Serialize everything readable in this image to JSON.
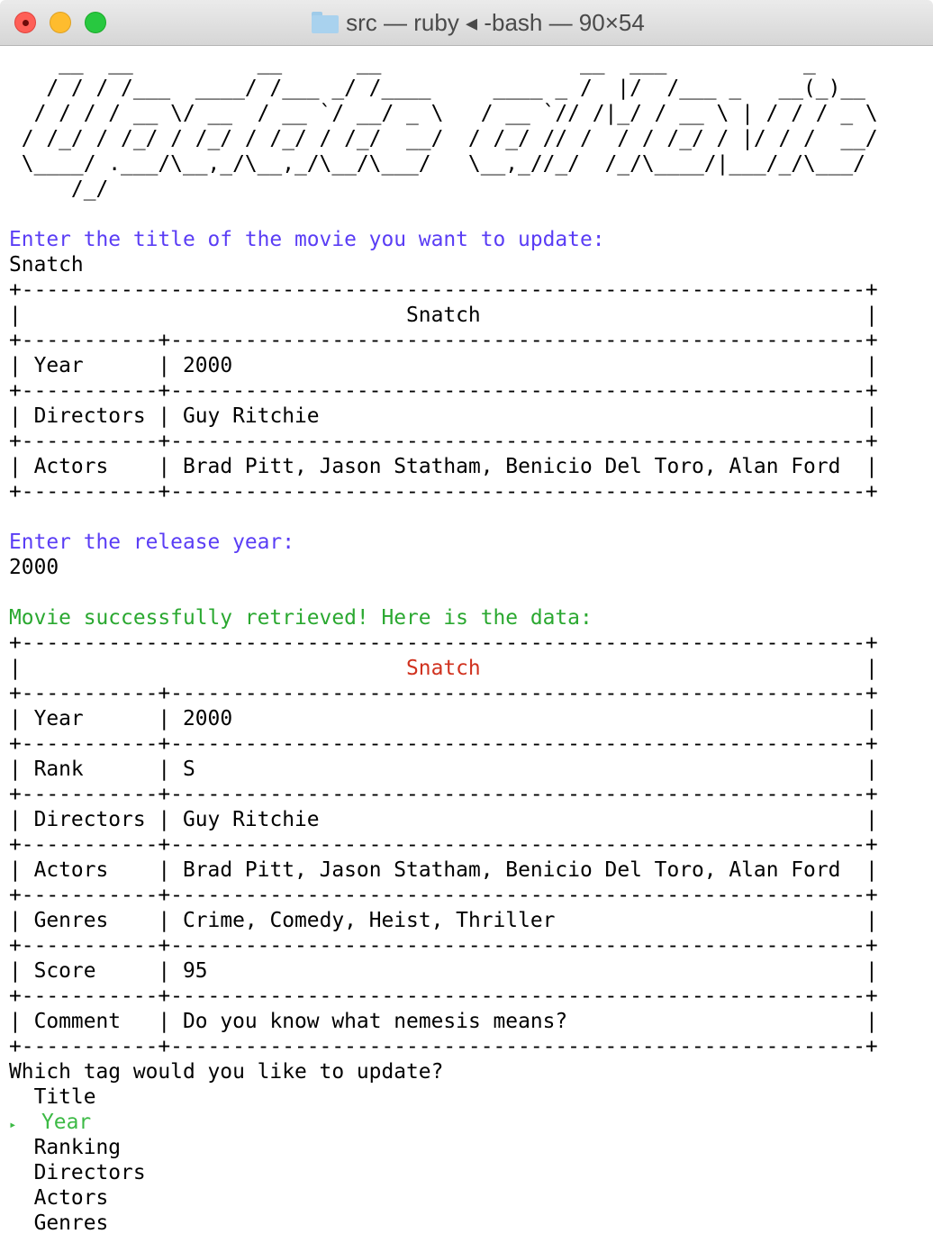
{
  "window": {
    "title": "src — ruby ◂ -bash — 90×54",
    "folder_icon": "folder-icon"
  },
  "banner": {
    "text": "Update a Movie",
    "ascii": [
      "    __  __          __      __                __  ___           _",
      "   / / / /___  ____/ /___ _/ /____     ____ _ /  |/  /___ _   __(_)__",
      "  / / / / __ \\/ __  / __ `/ __/ _ \\   / __ `// /|_/ / __ \\ | / / / _ \\",
      " / /_/ / /_/ / /_/ / /_/ / /_/  __/  / /_/ // /  / / /_/ / |/ / /  __/",
      " \\____/ .___/\\__,_/\\__,_/\\__/\\___/   \\__,_//_/  /_/\\____/|___/_/\\___/",
      "     /_/"
    ]
  },
  "prompts": {
    "title_prompt": "Enter the title of the movie you want to update:",
    "title_input": "Snatch",
    "year_prompt": "Enter the release year:",
    "year_input": "2000",
    "success_message": "Movie successfully retrieved! Here is the data:",
    "tag_question": "Which tag would you like to update?"
  },
  "search_table": {
    "title": "Snatch",
    "rows": [
      {
        "key": "Year",
        "value": "2000"
      },
      {
        "key": "Directors",
        "value": "Guy Ritchie"
      },
      {
        "key": "Actors",
        "value": "Brad Pitt, Jason Statham, Benicio Del Toro, Alan Ford"
      }
    ]
  },
  "result_table": {
    "title": "Snatch",
    "rows": [
      {
        "key": "Year",
        "value": "2000"
      },
      {
        "key": "Rank",
        "value": "S"
      },
      {
        "key": "Directors",
        "value": "Guy Ritchie"
      },
      {
        "key": "Actors",
        "value": "Brad Pitt, Jason Statham, Benicio Del Toro, Alan Ford"
      },
      {
        "key": "Genres",
        "value": "Crime, Comedy, Heist, Thriller"
      },
      {
        "key": "Score",
        "value": "95"
      },
      {
        "key": "Comment",
        "value": "Do you know what nemesis means?"
      }
    ]
  },
  "tag_menu": {
    "selected_index": 1,
    "pointer_icon": "▸",
    "options": [
      "Title",
      "Year",
      "Ranking",
      "Directors",
      "Actors",
      "Genres"
    ]
  },
  "colors": {
    "prompt": "#5a3df5",
    "success": "#2aa830",
    "title_highlight": "#d0311e",
    "selected_option": "#3cba45"
  }
}
